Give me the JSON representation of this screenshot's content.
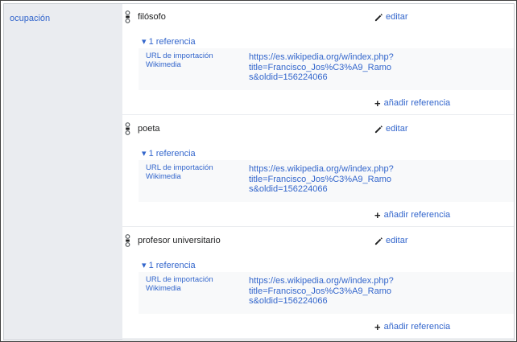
{
  "property": {
    "label": "ocupación"
  },
  "statements": [
    {
      "value": "filósofo",
      "edit_label": "editar",
      "ref_toggle": "▾ 1 referencia",
      "ref_property": "URL de importación Wikimedia",
      "ref_value": "https://es.wikipedia.org/w/index.php?title=Francisco_Jos%C3%A9_Ramos&oldid=156224066",
      "add_ref_label": "añadir referencia"
    },
    {
      "value": "poeta",
      "edit_label": "editar",
      "ref_toggle": "▾ 1 referencia",
      "ref_property": "URL de importación Wikimedia",
      "ref_value": "https://es.wikipedia.org/w/index.php?title=Francisco_Jos%C3%A9_Ramos&oldid=156224066",
      "add_ref_label": "añadir referencia"
    },
    {
      "value": "profesor universitario",
      "edit_label": "editar",
      "ref_toggle": "▾ 1 referencia",
      "ref_property": "URL de importación Wikimedia",
      "ref_value": "https://es.wikipedia.org/w/index.php?title=Francisco_Jos%C3%A9_Ramos&oldid=156224066",
      "add_ref_label": "añadir referencia"
    }
  ],
  "colors": {
    "link": "#3366cc",
    "property_bg": "#eaecf0",
    "reference_bg": "#f8f9fa"
  },
  "icons": {
    "rank": "rank-normal-icon",
    "edit": "pencil-icon",
    "add": "plus-icon"
  }
}
